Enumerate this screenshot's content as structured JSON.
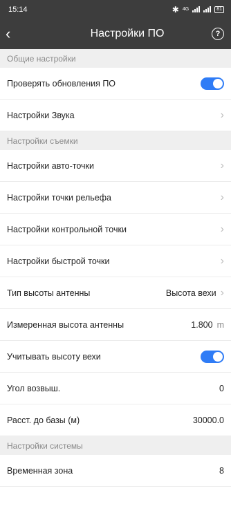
{
  "status": {
    "time": "15:14",
    "network": "4G",
    "battery": "81"
  },
  "header": {
    "title": "Настройки ПО"
  },
  "sections": [
    {
      "title": "Общие настройки"
    },
    {
      "title": "Настройки съемки"
    },
    {
      "title": "Настройки системы"
    }
  ],
  "general": {
    "check_updates": {
      "label": "Проверять обновления ПО",
      "enabled": true
    },
    "sound": {
      "label": "Настройки Звука"
    }
  },
  "survey": {
    "auto_point": {
      "label": "Настройки авто-точки"
    },
    "topo_point": {
      "label": "Настройки точки рельефа"
    },
    "control_point": {
      "label": "Настройки контрольной точки"
    },
    "quick_point": {
      "label": "Настройки быстрой точки"
    },
    "antenna_height_type": {
      "label": "Тип высоты антенны",
      "value": "Высота вехи"
    },
    "measured_antenna_height": {
      "label": "Измеренная высота антенны",
      "value": "1.800",
      "unit": "m"
    },
    "consider_pole_height": {
      "label": "Учитывать высоту вехи",
      "enabled": true
    },
    "elevation_angle": {
      "label": "Угол возвыш.",
      "value": "0"
    },
    "base_distance": {
      "label": "Расст. до базы (м)",
      "value": "30000.0"
    }
  },
  "system": {
    "time_zone": {
      "label": "Временная зона",
      "value": "8"
    }
  },
  "colors": {
    "accent": "#2f7cf6",
    "header": "#3d3d3d",
    "section_bg": "#efefef"
  }
}
